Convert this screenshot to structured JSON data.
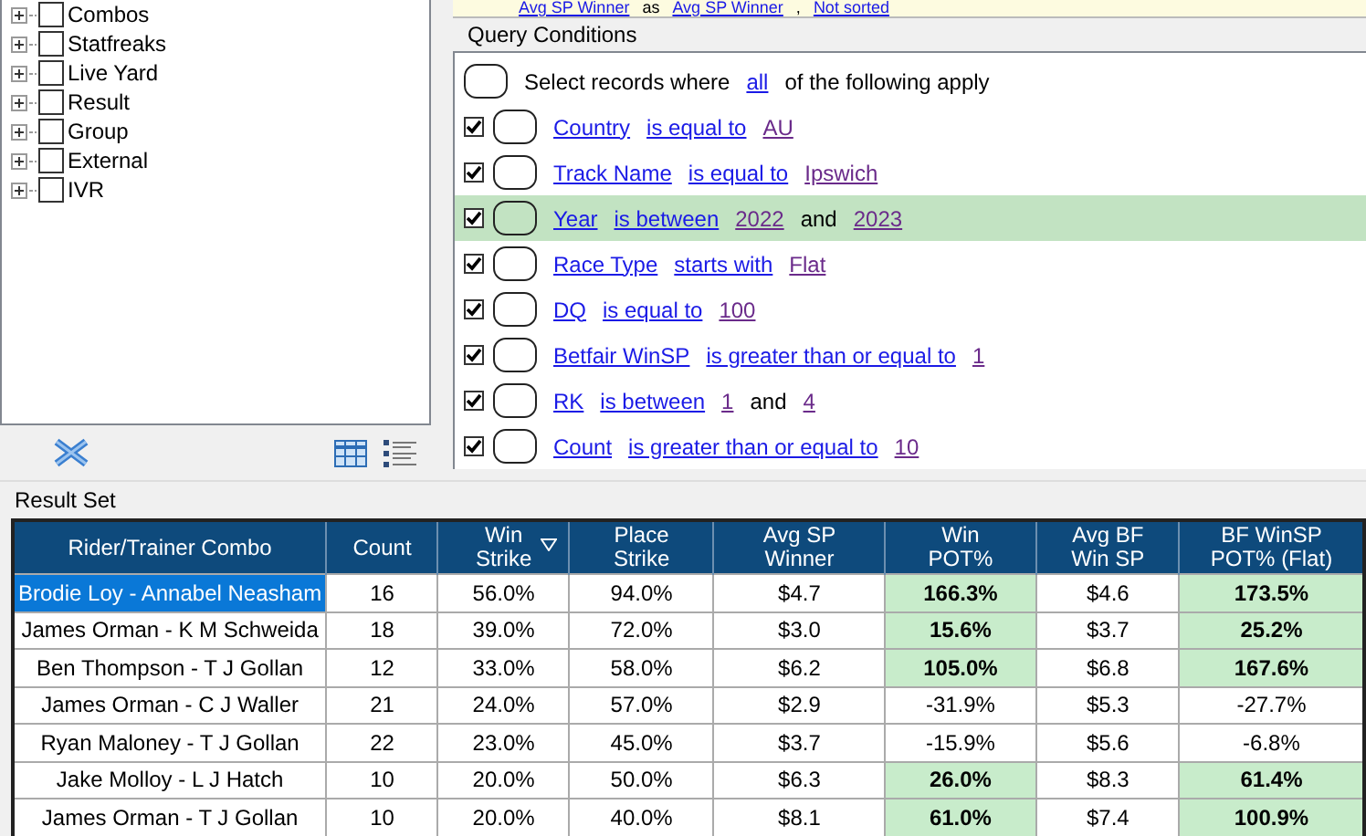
{
  "tree": {
    "items": [
      {
        "label": "Combos",
        "checked": false,
        "expanded": false
      },
      {
        "label": "Statfreaks",
        "checked": false,
        "expanded": false
      },
      {
        "label": "Live Yard",
        "checked": false,
        "expanded": false
      },
      {
        "label": "Result",
        "checked": false,
        "expanded": false
      },
      {
        "label": "Group",
        "checked": false,
        "expanded": false
      },
      {
        "label": "External",
        "checked": false,
        "expanded": false
      },
      {
        "label": "IVR",
        "checked": false,
        "expanded": false
      }
    ]
  },
  "sort_strip": {
    "parts": [
      {
        "kind": "field",
        "text": "Avg SP Winner"
      },
      {
        "kind": "text",
        "text": "as"
      },
      {
        "kind": "field",
        "text": "Avg SP Winner"
      },
      {
        "kind": "text",
        "text": ","
      },
      {
        "kind": "field",
        "text": "Not sorted"
      }
    ]
  },
  "query_conditions": {
    "title": "Query Conditions",
    "intro": [
      {
        "kind": "text",
        "text": "Select records where"
      },
      {
        "kind": "field",
        "text": "all"
      },
      {
        "kind": "text",
        "text": "of the following apply"
      }
    ],
    "conditions": [
      {
        "checked": true,
        "selected": false,
        "parts": [
          {
            "kind": "field",
            "text": "Country"
          },
          {
            "kind": "field",
            "text": "is equal to"
          },
          {
            "kind": "value",
            "text": "AU"
          }
        ]
      },
      {
        "checked": true,
        "selected": false,
        "parts": [
          {
            "kind": "field",
            "text": "Track Name"
          },
          {
            "kind": "field",
            "text": "is equal to"
          },
          {
            "kind": "value",
            "text": "Ipswich"
          }
        ]
      },
      {
        "checked": true,
        "selected": true,
        "parts": [
          {
            "kind": "field",
            "text": "Year"
          },
          {
            "kind": "field",
            "text": "is between"
          },
          {
            "kind": "value",
            "text": "2022"
          },
          {
            "kind": "text",
            "text": "and"
          },
          {
            "kind": "value",
            "text": "2023"
          }
        ]
      },
      {
        "checked": true,
        "selected": false,
        "parts": [
          {
            "kind": "field",
            "text": "Race Type"
          },
          {
            "kind": "field",
            "text": "starts with"
          },
          {
            "kind": "value",
            "text": "Flat"
          }
        ]
      },
      {
        "checked": true,
        "selected": false,
        "parts": [
          {
            "kind": "field",
            "text": "DQ"
          },
          {
            "kind": "field",
            "text": "is equal to"
          },
          {
            "kind": "value",
            "text": "100"
          }
        ]
      },
      {
        "checked": true,
        "selected": false,
        "parts": [
          {
            "kind": "field",
            "text": "Betfair WinSP"
          },
          {
            "kind": "field",
            "text": "is greater than or equal to"
          },
          {
            "kind": "value",
            "text": "1"
          }
        ]
      },
      {
        "checked": true,
        "selected": false,
        "parts": [
          {
            "kind": "field",
            "text": "RK"
          },
          {
            "kind": "field",
            "text": "is between"
          },
          {
            "kind": "value",
            "text": "1"
          },
          {
            "kind": "text",
            "text": "and"
          },
          {
            "kind": "value",
            "text": "4"
          }
        ]
      },
      {
        "checked": true,
        "selected": false,
        "parts": [
          {
            "kind": "field",
            "text": "Count"
          },
          {
            "kind": "field",
            "text": "is greater than or equal to"
          },
          {
            "kind": "value",
            "text": "10"
          }
        ]
      }
    ]
  },
  "result_set": {
    "title": "Result Set",
    "columns": [
      {
        "label": "Rider/Trainer Combo",
        "sorted": false
      },
      {
        "label": "Count",
        "sorted": false
      },
      {
        "label": "Win\nStrike",
        "sorted": true
      },
      {
        "label": "Place\nStrike",
        "sorted": false
      },
      {
        "label": "Avg SP\nWinner",
        "sorted": false
      },
      {
        "label": "Win\nPOT%",
        "sorted": false
      },
      {
        "label": "Avg BF\nWin SP",
        "sorted": false
      },
      {
        "label": "BF WinSP\nPOT% (Flat)",
        "sorted": false
      }
    ],
    "rows": [
      {
        "selected": true,
        "cells": [
          {
            "text": "Brodie Loy - Annabel Neasham",
            "highlighted": false
          },
          {
            "text": "16",
            "highlighted": false
          },
          {
            "text": "56.0%",
            "highlighted": false
          },
          {
            "text": "94.0%",
            "highlighted": false
          },
          {
            "text": "$4.7",
            "highlighted": false
          },
          {
            "text": "166.3%",
            "highlighted": true
          },
          {
            "text": "$4.6",
            "highlighted": false
          },
          {
            "text": "173.5%",
            "highlighted": true
          }
        ]
      },
      {
        "selected": false,
        "cells": [
          {
            "text": "James Orman - K M Schweida",
            "highlighted": false
          },
          {
            "text": "18",
            "highlighted": false
          },
          {
            "text": "39.0%",
            "highlighted": false
          },
          {
            "text": "72.0%",
            "highlighted": false
          },
          {
            "text": "$3.0",
            "highlighted": false
          },
          {
            "text": "15.6%",
            "highlighted": true
          },
          {
            "text": "$3.7",
            "highlighted": false
          },
          {
            "text": "25.2%",
            "highlighted": true
          }
        ]
      },
      {
        "selected": false,
        "cells": [
          {
            "text": "Ben Thompson - T J Gollan",
            "highlighted": false
          },
          {
            "text": "12",
            "highlighted": false
          },
          {
            "text": "33.0%",
            "highlighted": false
          },
          {
            "text": "58.0%",
            "highlighted": false
          },
          {
            "text": "$6.2",
            "highlighted": false
          },
          {
            "text": "105.0%",
            "highlighted": true
          },
          {
            "text": "$6.8",
            "highlighted": false
          },
          {
            "text": "167.6%",
            "highlighted": true
          }
        ]
      },
      {
        "selected": false,
        "cells": [
          {
            "text": "James Orman - C J Waller",
            "highlighted": false
          },
          {
            "text": "21",
            "highlighted": false
          },
          {
            "text": "24.0%",
            "highlighted": false
          },
          {
            "text": "57.0%",
            "highlighted": false
          },
          {
            "text": "$2.9",
            "highlighted": false
          },
          {
            "text": "-31.9%",
            "highlighted": false
          },
          {
            "text": "$5.3",
            "highlighted": false
          },
          {
            "text": "-27.7%",
            "highlighted": false
          }
        ]
      },
      {
        "selected": false,
        "cells": [
          {
            "text": "Ryan Maloney - T J Gollan",
            "highlighted": false
          },
          {
            "text": "22",
            "highlighted": false
          },
          {
            "text": "23.0%",
            "highlighted": false
          },
          {
            "text": "45.0%",
            "highlighted": false
          },
          {
            "text": "$3.7",
            "highlighted": false
          },
          {
            "text": "-15.9%",
            "highlighted": false
          },
          {
            "text": "$5.6",
            "highlighted": false
          },
          {
            "text": "-6.8%",
            "highlighted": false
          }
        ]
      },
      {
        "selected": false,
        "cells": [
          {
            "text": "Jake Molloy - L J Hatch",
            "highlighted": false
          },
          {
            "text": "10",
            "highlighted": false
          },
          {
            "text": "20.0%",
            "highlighted": false
          },
          {
            "text": "50.0%",
            "highlighted": false
          },
          {
            "text": "$6.3",
            "highlighted": false
          },
          {
            "text": "26.0%",
            "highlighted": true
          },
          {
            "text": "$8.3",
            "highlighted": false
          },
          {
            "text": "61.4%",
            "highlighted": true
          }
        ]
      },
      {
        "selected": false,
        "cells": [
          {
            "text": "James Orman - T J Gollan",
            "highlighted": false
          },
          {
            "text": "10",
            "highlighted": false
          },
          {
            "text": "20.0%",
            "highlighted": false
          },
          {
            "text": "40.0%",
            "highlighted": false
          },
          {
            "text": "$8.1",
            "highlighted": false
          },
          {
            "text": "61.0%",
            "highlighted": true
          },
          {
            "text": "$7.4",
            "highlighted": false
          },
          {
            "text": "100.9%",
            "highlighted": true
          }
        ]
      }
    ]
  }
}
